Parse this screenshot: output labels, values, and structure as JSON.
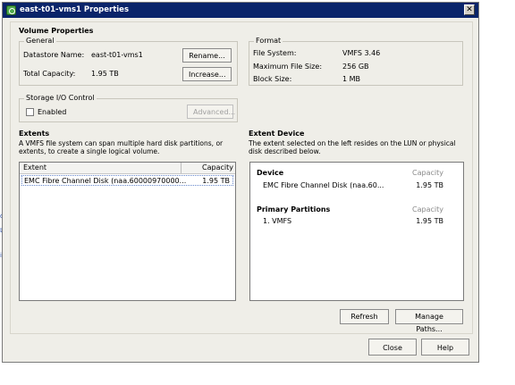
{
  "window": {
    "title": "east-t01-vms1 Properties",
    "close_glyph": "✕",
    "icon": "datastore-icon"
  },
  "volume_properties": {
    "heading": "Volume Properties",
    "general": {
      "legend": "General",
      "datastore_name_label": "Datastore Name:",
      "datastore_name_value": "east-t01-vms1",
      "total_capacity_label": "Total Capacity:",
      "total_capacity_value": "1.95 TB",
      "rename_button": "Rename...",
      "increase_button": "Increase..."
    },
    "format": {
      "legend": "Format",
      "file_system_label": "File System:",
      "file_system_value": "VMFS 3.46",
      "max_file_size_label": "Maximum File Size:",
      "max_file_size_value": "256 GB",
      "block_size_label": "Block Size:",
      "block_size_value": "1 MB"
    },
    "storage_io": {
      "legend": "Storage I/O Control",
      "enabled_label": "Enabled",
      "enabled_checked": false,
      "advanced_button": "Advanced..."
    }
  },
  "extents": {
    "heading": "Extents",
    "description": [
      "A VMFS file system can span multiple hard disk partitions, or",
      "extents, to create a single logical volume."
    ],
    "columns": [
      "Extent",
      "Capacity"
    ],
    "rows": [
      {
        "extent": "EMC Fibre Channel Disk (naa.60000970000...",
        "capacity": "1.95 TB"
      }
    ]
  },
  "extent_device": {
    "heading": "Extent Device",
    "description": [
      "The extent selected on the left resides on the LUN or physical",
      "disk described below."
    ],
    "device_label": "Device",
    "capacity_label": "Capacity",
    "device_name": "EMC Fibre Channel Disk (naa.60...",
    "device_capacity": "1.95 TB",
    "partitions_label": "Primary Partitions",
    "partitions_capacity_label": "Capacity",
    "partition_name": "1. VMFS",
    "partition_capacity": "1.95 TB"
  },
  "actions": {
    "refresh": "Refresh",
    "manage_paths": "Manage Paths..."
  },
  "footer": {
    "close": "Close",
    "help": "Help"
  }
}
